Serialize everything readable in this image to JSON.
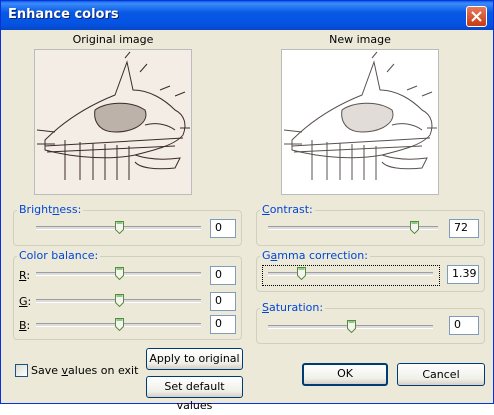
{
  "window": {
    "title": "Enhance colors"
  },
  "images": {
    "original_label": "Original image",
    "new_label": "New image"
  },
  "brightness": {
    "label_prefix": "Bright",
    "label_key": "n",
    "label_suffix": "ess:",
    "value": "0",
    "level": 0.5
  },
  "color_balance": {
    "title": "Color balance:",
    "r": {
      "label": "R",
      "value": "0",
      "level": 0.5
    },
    "g": {
      "label": "G",
      "value": "0",
      "level": 0.5
    },
    "b": {
      "label": "B",
      "value": "0",
      "level": 0.5
    }
  },
  "contrast": {
    "label_key": "C",
    "label_rest": "ontrast:",
    "value": "72",
    "level": 0.86
  },
  "gamma": {
    "label_prefix": "G",
    "label_key": "a",
    "label_suffix": "mma correction:",
    "value": "1.39",
    "level": 0.2
  },
  "saturation": {
    "label_key": "S",
    "label_rest": "aturation:",
    "value": "0",
    "level": 0.5
  },
  "save_values": {
    "label_prefix": "Save ",
    "label_key": "v",
    "label_suffix": "alues on exit",
    "checked": false
  },
  "buttons": {
    "apply": "Apply to original",
    "defaults": "Set default values",
    "ok": "OK",
    "cancel": "Cancel"
  },
  "colors": {
    "accent": "#0046d5",
    "titlebar": "#0858e6",
    "face": "#ece9d8"
  }
}
